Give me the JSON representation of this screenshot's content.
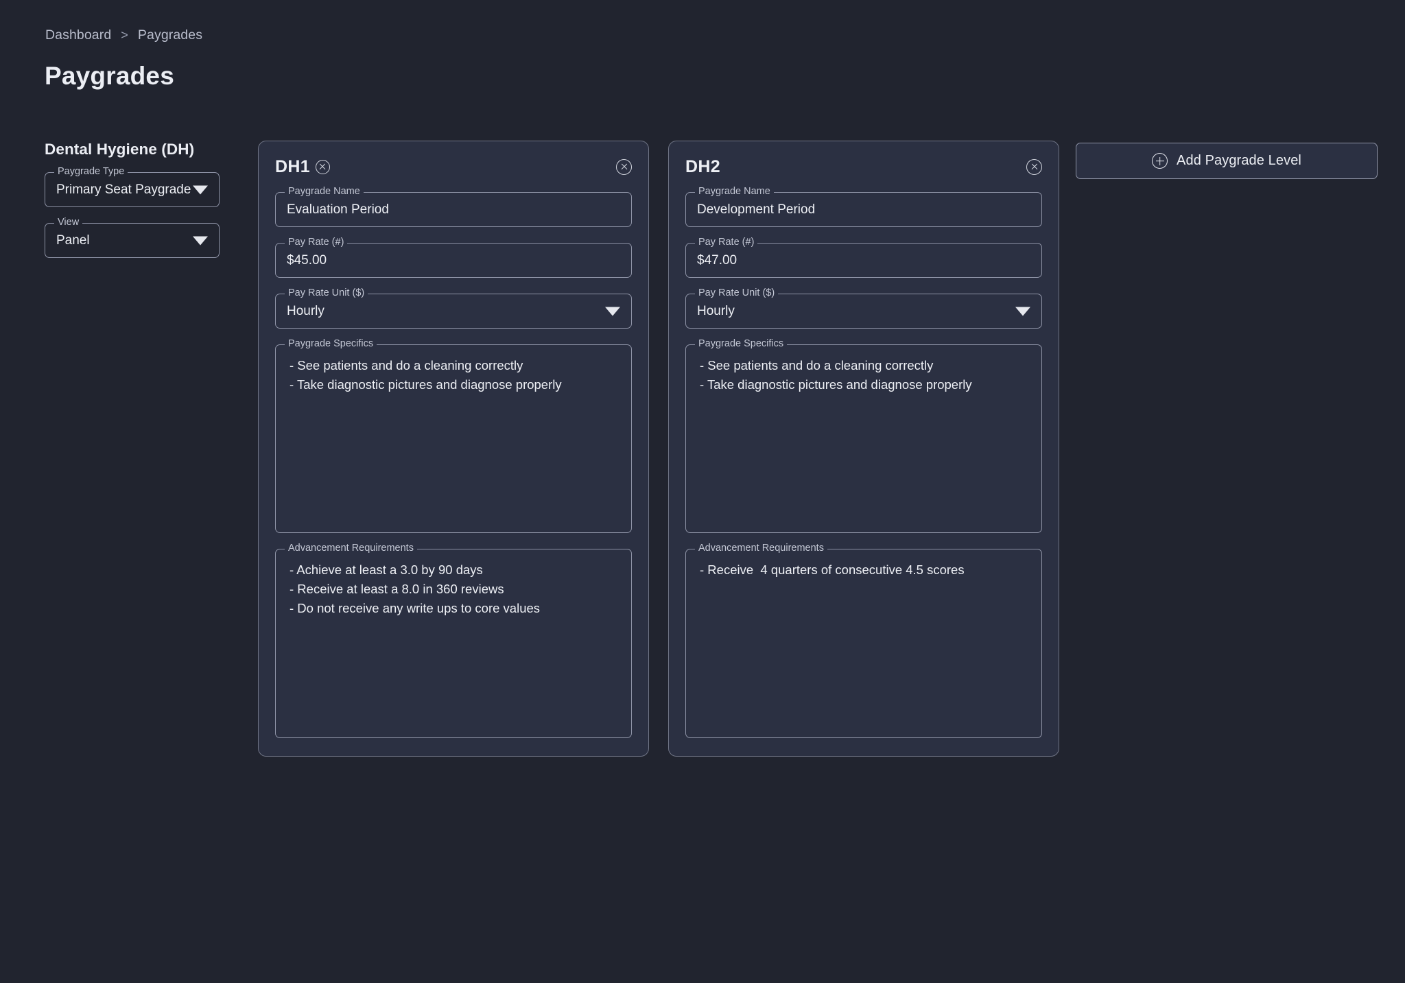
{
  "breadcrumb": {
    "items": [
      "Dashboard",
      "Paygrades"
    ],
    "separator": ">"
  },
  "page": {
    "title": "Paygrades"
  },
  "sidebar": {
    "group_title": "Dental Hygiene (DH)",
    "fields": [
      {
        "label": "Paygrade Type",
        "value": "Primary Seat Paygrade",
        "icon": "chevron-down-icon"
      },
      {
        "label": "View",
        "value": "Panel",
        "icon": "chevron-down-icon"
      }
    ]
  },
  "cards": [
    {
      "title": "DH1",
      "title_close_icon": "close-circle-icon",
      "card_close_icon": "close-circle-icon",
      "fields": {
        "paygrade_name": {
          "label": "Paygrade Name",
          "value": "Evaluation Period"
        },
        "pay_rate": {
          "label": "Pay Rate (#)",
          "value": "$45.00"
        },
        "pay_rate_unit": {
          "label": "Pay Rate Unit ($)",
          "value": "Hourly",
          "icon": "chevron-down-icon"
        },
        "paygrade_specifics": {
          "label": "Paygrade Specifics",
          "value": "- See patients and do a cleaning correctly\n- Take diagnostic pictures and diagnose properly"
        },
        "advancement_requirements": {
          "label": "Advancement Requirements",
          "value": "- Achieve at least a 3.0 by 90 days\n- Receive at least a 8.0 in 360 reviews\n- Do not receive any write ups to core values"
        }
      }
    },
    {
      "title": "DH2",
      "title_close_icon": null,
      "card_close_icon": "close-circle-icon",
      "fields": {
        "paygrade_name": {
          "label": "Paygrade Name",
          "value": "Development Period"
        },
        "pay_rate": {
          "label": "Pay Rate (#)",
          "value": "$47.00"
        },
        "pay_rate_unit": {
          "label": "Pay Rate Unit ($)",
          "value": "Hourly",
          "icon": "chevron-down-icon"
        },
        "paygrade_specifics": {
          "label": "Paygrade Specifics",
          "value": "- See patients and do a cleaning correctly\n- Take diagnostic pictures and diagnose properly"
        },
        "advancement_requirements": {
          "label": "Advancement Requirements",
          "value": "- Receive  4 quarters of consecutive 4.5 scores"
        }
      }
    }
  ],
  "add_button": {
    "label": "Add Paygrade Level",
    "icon": "plus-circle-icon"
  },
  "colors": {
    "page_background": "#21242f",
    "card_background": "#2b3042",
    "border": "#8e93a6",
    "text_primary": "#eef0f5",
    "text_muted": "#b9bdcc"
  }
}
